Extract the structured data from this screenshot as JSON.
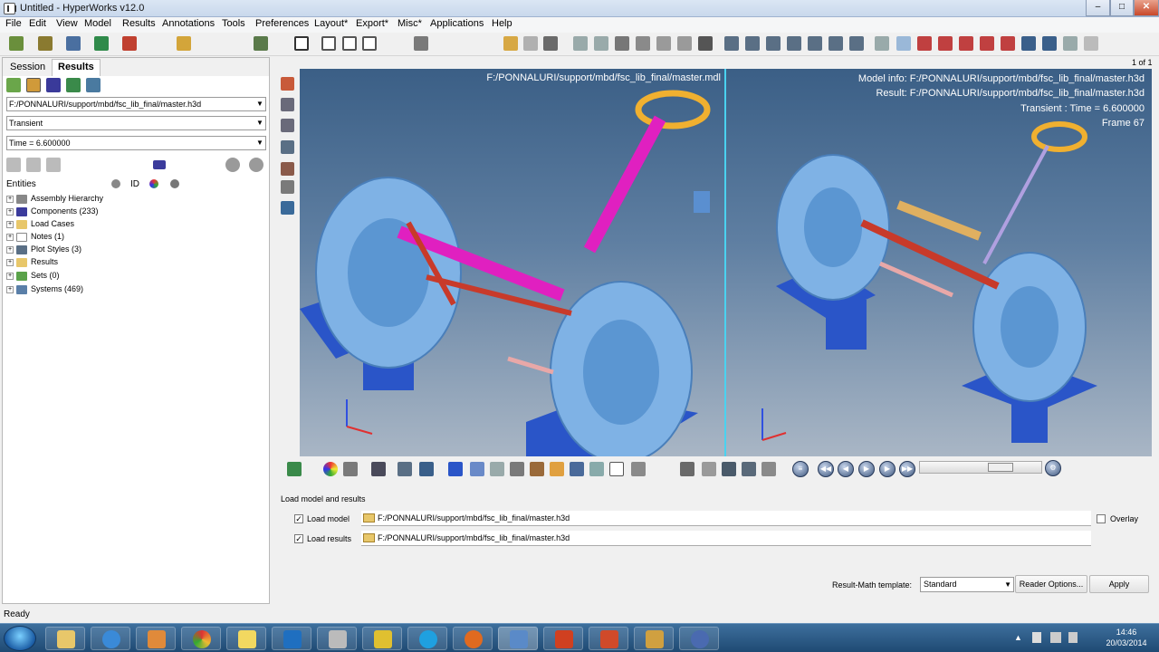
{
  "window": {
    "title": "Untitled - HyperWorks v12.0",
    "min_label": "–",
    "max_label": "□",
    "close_label": "✕"
  },
  "menu": [
    "File",
    "Edit",
    "View",
    "Model",
    "Results",
    "Annotations",
    "Tools",
    "Preferences",
    "Layout*",
    "Export*",
    "Misc*",
    "Applications",
    "Help"
  ],
  "page_counter": "1 of 1",
  "panel": {
    "tabs": [
      "Session",
      "Results"
    ],
    "model_path": "F:/PONNALURI/support/mbd/fsc_lib_final/master.h3d",
    "result_type": "Transient",
    "time_value": "Time = 6.600000",
    "entities_header": "Entities",
    "id_label": "ID",
    "tree": [
      "Assembly Hierarchy",
      "Components (233)",
      "Load Cases",
      "Notes (1)",
      "Plot Styles (3)",
      "Results",
      "Sets (0)",
      "Systems (469)"
    ]
  },
  "viewport_left": {
    "path": "F:/PONNALURI/support/mbd/fsc_lib_final/master.mdl"
  },
  "viewport_right": {
    "model_info": "Model info: F:/PONNALURI/support/mbd/fsc_lib_final/master.h3d",
    "result": "Result: F:/PONNALURI/support/mbd/fsc_lib_final/master.h3d",
    "time": "Transient : Time = 6.600000",
    "frame": "Frame 67"
  },
  "load_panel": {
    "heading": "Load model and results",
    "load_model_label": "Load model",
    "load_model_path": "F:/PONNALURI/support/mbd/fsc_lib_final/master.h3d",
    "load_results_label": "Load results",
    "load_results_path": "F:/PONNALURI/support/mbd/fsc_lib_final/master.h3d",
    "overlay_label": "Overlay",
    "template_label": "Result-Math template:",
    "template_value": "Standard",
    "reader_button": "Reader Options...",
    "apply_button": "Apply"
  },
  "status": "Ready",
  "clock": {
    "time": "14:46",
    "date": "20/03/2014"
  },
  "colors": {
    "accent": "#3b5f86",
    "divider": "#4ad2f0",
    "taskbar": "#1f4a73"
  }
}
